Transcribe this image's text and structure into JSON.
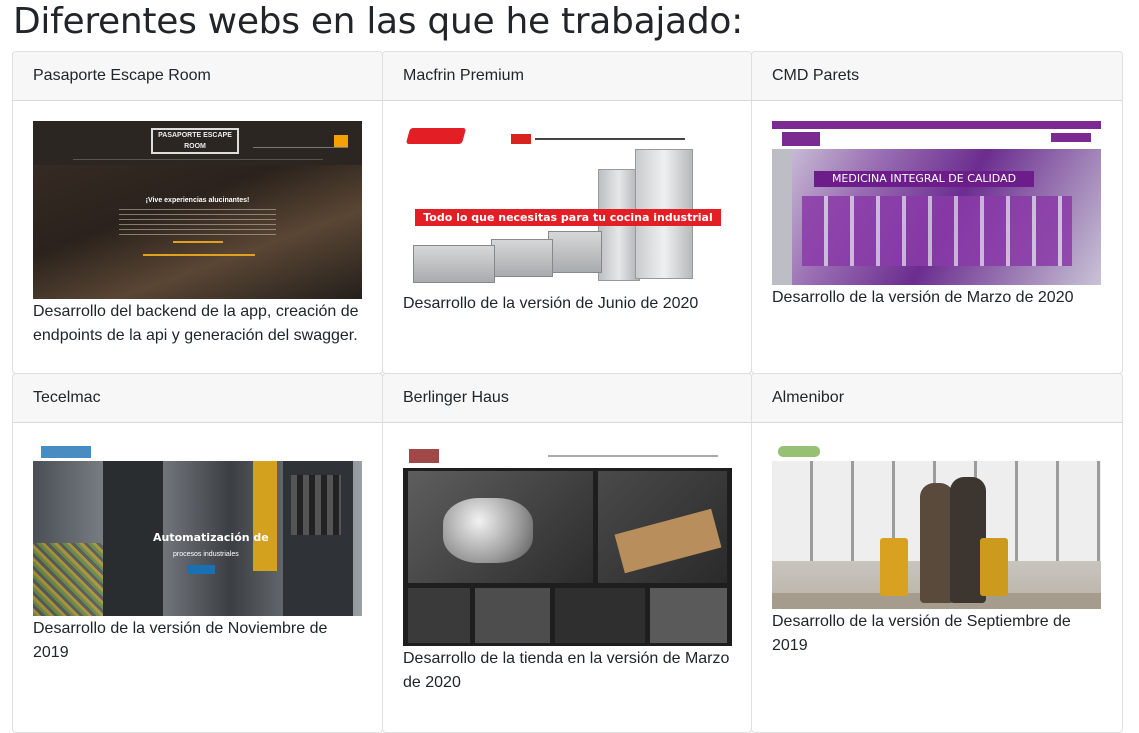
{
  "page": {
    "title": "Diferentes webs en las que he trabajado:"
  },
  "projects": [
    {
      "name": "Pasaporte Escape Room",
      "screenshot": {
        "logo_text": "PASAPORTE ESCAPE ROOM",
        "headline": "¡Vive experiencias alucinantes!"
      },
      "description": "Desarrollo del backend de la app, creación de endpoints de la api y generación del swagger."
    },
    {
      "name": "Macfrin Premium",
      "screenshot": {
        "banner": "Todo lo que necesitas para tu cocina industrial"
      },
      "description": "Desarrollo de la versión de Junio de 2020"
    },
    {
      "name": "CMD Parets",
      "screenshot": {
        "sign": "MEDICINA INTEGRAL DE CALIDAD"
      },
      "description": "Desarrollo de la versión de Marzo de 2020"
    },
    {
      "name": "Tecelmac",
      "screenshot": {
        "headline": "Automatización de",
        "subline": "procesos industriales"
      },
      "description": "Desarrollo de la versión de Noviembre de 2019"
    },
    {
      "name": "Berlinger Haus",
      "screenshot": {},
      "description": "Desarrollo de la tienda en la versión de Marzo de 2020"
    },
    {
      "name": "Almenibor",
      "screenshot": {},
      "description": "Desarrollo de la versión de Septiembre de 2019"
    }
  ]
}
